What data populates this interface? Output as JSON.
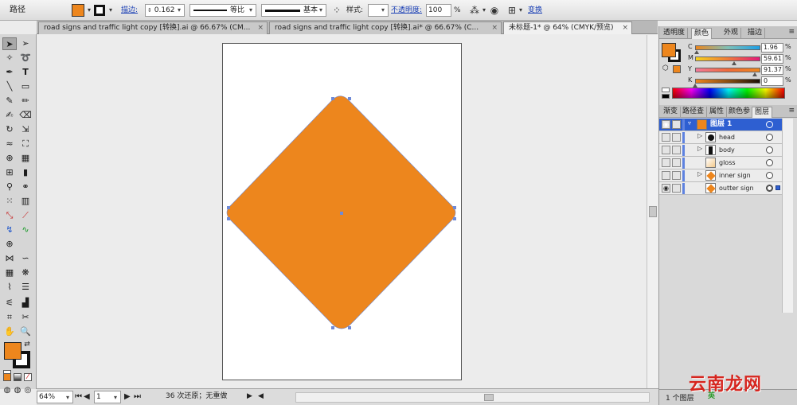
{
  "control_bar": {
    "object_type": "路径",
    "fill_color": "#ed861d",
    "stroke_label": "描边:",
    "stroke_weight": "0.162",
    "profile_label": "等比",
    "brush_label": "基本",
    "style_label": "样式:",
    "opacity_label": "不透明度:",
    "opacity_value": "100",
    "opacity_unit": "%",
    "transform_label": "变换"
  },
  "document_tabs": [
    {
      "label": "road signs and traffic light copy [转换].ai @ 66.67% (CM..."
    },
    {
      "label": "road signs and traffic light copy [转换].ai* @ 66.67% (C..."
    },
    {
      "label": "未标题-1* @ 64% (CMYK/预览)"
    }
  ],
  "tab_close_glyph": "×",
  "status_bar": {
    "zoom": "64%",
    "page": "1",
    "undo_text": "36 次还原；无重做"
  },
  "color_panel": {
    "tabs": [
      "透明度",
      "颜色",
      "外观",
      "描边"
    ],
    "active_tab": "颜色",
    "channels": [
      {
        "name": "C",
        "value": "1.96",
        "unit": "%",
        "level": 0.0196
      },
      {
        "name": "M",
        "value": "59.61",
        "unit": "%",
        "level": 0.5961
      },
      {
        "name": "Y",
        "value": "91.37",
        "unit": "%",
        "level": 0.9137
      },
      {
        "name": "K",
        "value": "0",
        "unit": "%",
        "level": 0
      }
    ],
    "swatch_color": "#ed861d"
  },
  "layers_panel": {
    "tabs": [
      "渐变",
      "路径查",
      "属性",
      "颜色参",
      "图层"
    ],
    "active_tab": "图层",
    "layers": [
      {
        "name": "图层 1",
        "thumb": "orange"
      },
      {
        "name": "head",
        "thumb": "black-circle"
      },
      {
        "name": "body",
        "thumb": "figure"
      },
      {
        "name": "gloss",
        "thumb": "gloss"
      },
      {
        "name": "inner sign",
        "thumb": "orange"
      },
      {
        "name": "outter sign",
        "thumb": "orange"
      }
    ],
    "footer_text": "1 个图层"
  },
  "watermark": {
    "text": "云南龙网",
    "sub": "英"
  },
  "canvas": {
    "shape_color": "#ed861d",
    "anchor_color": "#6f8ad6"
  }
}
